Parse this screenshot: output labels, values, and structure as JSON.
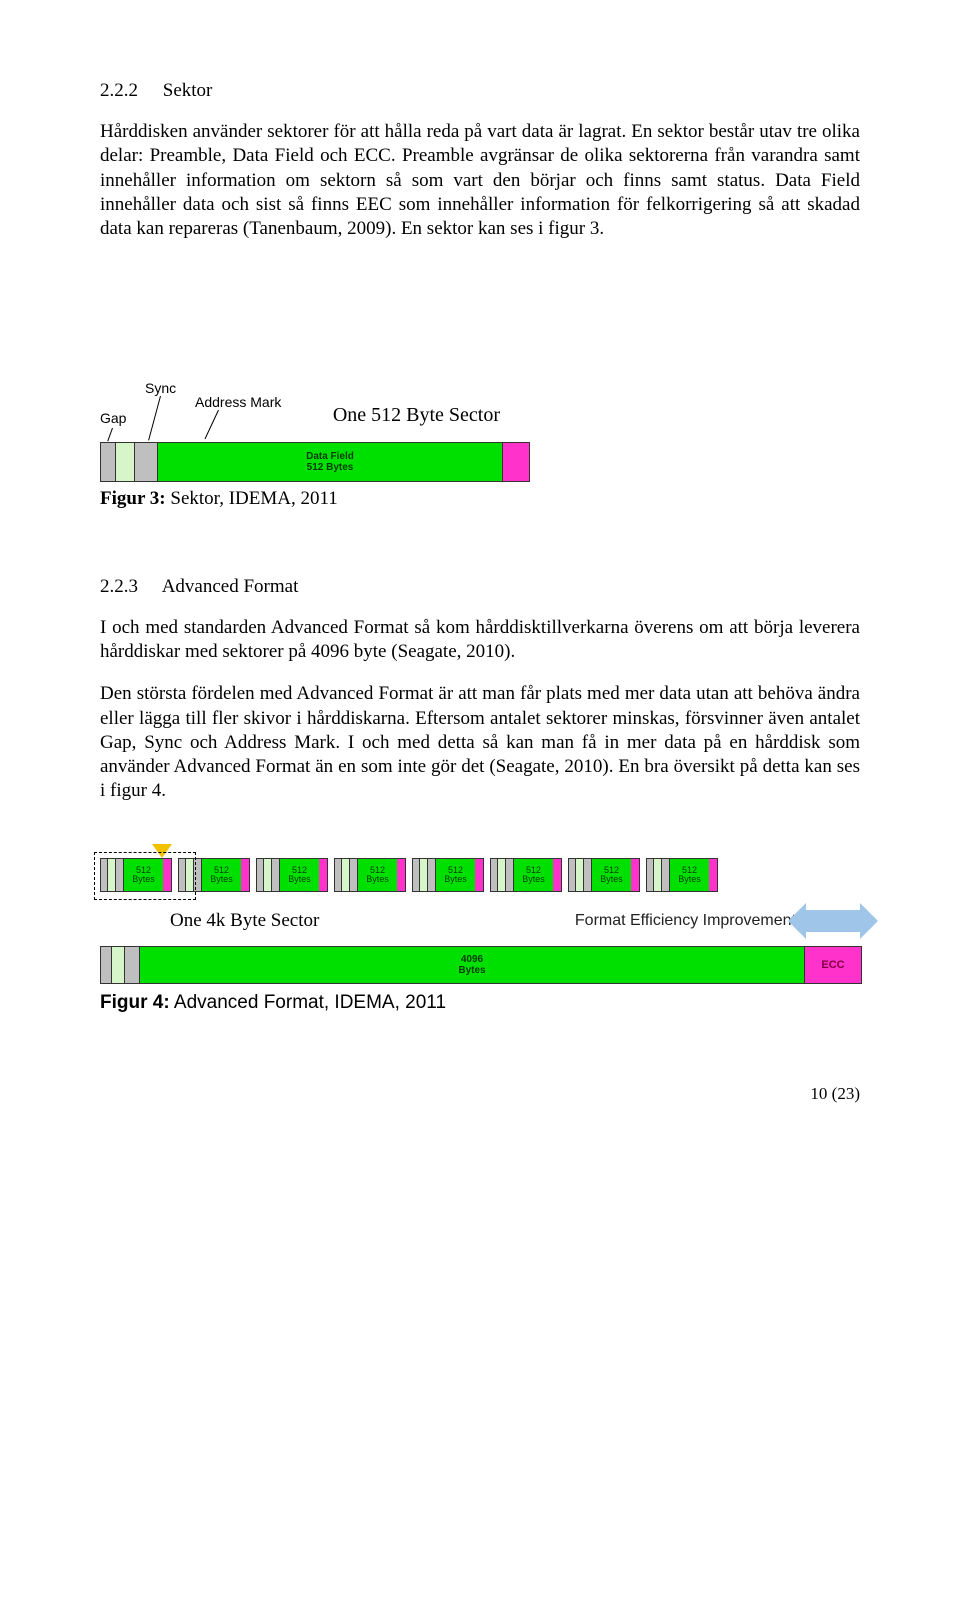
{
  "section222": {
    "num": "2.2.2",
    "title": "Sektor",
    "para": "Hårddisken använder sektorer för att hålla reda på vart data är lagrat. En sektor består utav tre olika delar: Preamble, Data Field och ECC. Preamble avgränsar de olika sektorerna från varandra samt innehåller information om sektorn så som vart den börjar och finns samt status. Data Field innehåller data och sist så finns EEC som innehåller information för felkorrigering så att skadad data kan repareras (Tanenbaum, 2009). En sektor kan ses i figur 3."
  },
  "fig3": {
    "gap": "Gap",
    "sync": "Sync",
    "addr": "Address Mark",
    "title": "One 512 Byte Sector",
    "dataLabel1": "Data Field",
    "dataLabel2": "512 Bytes",
    "caption_bold": "Figur 3:",
    "caption_rest": " Sektor, IDEMA, 2011"
  },
  "section223": {
    "num": "2.2.3",
    "title": "Advanced Format",
    "para1": "I och med standarden Advanced Format så kom hårddisktillverkarna överens om att börja leverera hårddiskar med sektorer på 4096 byte (Seagate, 2010).",
    "para2": "Den största fördelen med Advanced Format är att man får plats med mer data utan att behöva ändra eller lägga till fler skivor i hårddiskarna. Eftersom antalet sektorer minskas, försvinner även antalet Gap, Sync och Address Mark. I och med detta så kan man få in mer data på en hårddisk som använder Advanced Format än en som inte gör det (Seagate, 2010). En bra översikt på detta kan ses i figur 4."
  },
  "fig4": {
    "mini_l1": "512",
    "mini_l2": "Bytes",
    "left_title": "One 4k Byte Sector",
    "right_title": "Format Efficiency Improvement",
    "big_l1": "4096",
    "big_l2": "Bytes",
    "ecc": "ECC",
    "caption_bold": "Figur 4:",
    "caption_rest": " Advanced Format, IDEMA, 2011"
  },
  "pagenum": "10 (23)"
}
